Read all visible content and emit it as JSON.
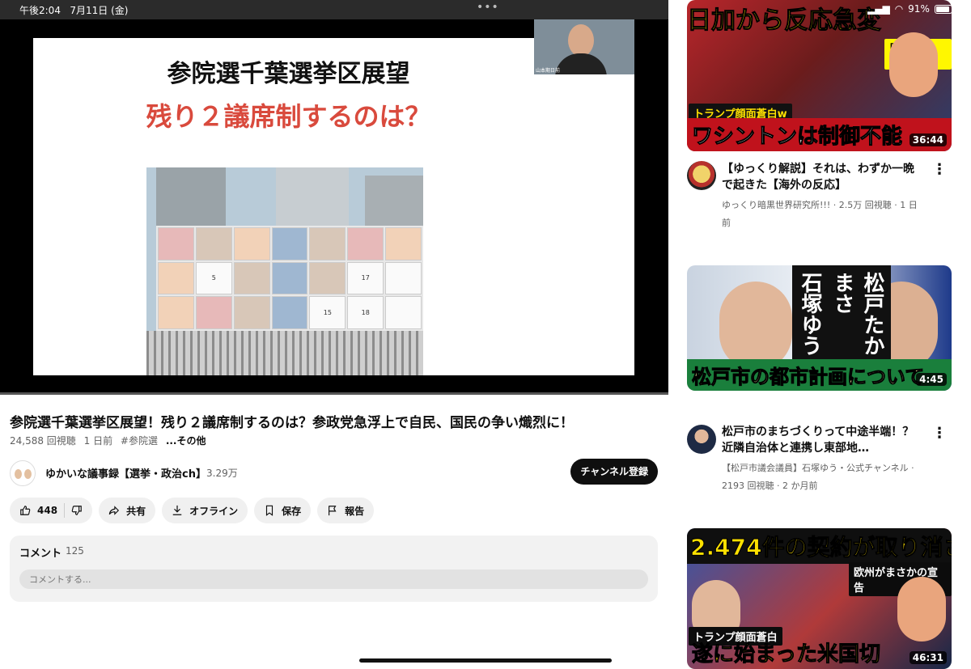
{
  "status_bar": {
    "time": "午後2:04",
    "date": "7月11日 (金)",
    "battery": "91%"
  },
  "slide": {
    "title": "参院選千葉選挙区展望",
    "subtitle": "残り２議席制するのは？",
    "board_numbers": [
      "5",
      "17",
      "15",
      "18"
    ],
    "webcam_tag": "山本期日前"
  },
  "video": {
    "title": "参院選千葉選挙区展望！残り２議席制するのは？参政党急浮上で自民、国民の争い熾烈に！",
    "views": "24,588 回視聴",
    "age": "1 日前",
    "hashtag": "#参院選",
    "more": "...その他"
  },
  "channel": {
    "name": "ゆかいな議事録【選挙・政治ch】",
    "subs": "3.29万",
    "subscribe_label": "チャンネル登録"
  },
  "actions": {
    "like_count": "448",
    "share": "共有",
    "offline": "オフライン",
    "save": "保存",
    "report": "報告"
  },
  "comments": {
    "header": "コメント",
    "count": "125",
    "placeholder": "コメントする..."
  },
  "recommended": [
    {
      "thumb_top": "日加から反応急変",
      "thumb_tag": "目を疑った…",
      "thumb_mid": "トランプ顔面蒼白w",
      "thumb_bottom": "ワシントンは制御不能",
      "duration": "36:44",
      "title": "【ゆっくり解説】それは、わずか一晩で起きた【海外の反応】",
      "meta": "ゆっくり暗黒世界研究所!!! · 2.5万 回視聴 · 1 日前"
    },
    {
      "thumb_names_1": "石塚ゆう",
      "thumb_names_2": "松戸たかまさ",
      "thumb_bottom": "松戸市の都市計画について",
      "duration": "4:45",
      "title": "松戸市のまちづくりって中途半端！？近隣自治体と連携し東部地…",
      "meta": "【松戸市議会議員】石塚ゆう・公式チャンネル · 2193 回視聴 · 2 か月前"
    },
    {
      "thumb_top": "2.474件の契約が取り消され",
      "thumb_tag": "欧州がまさかの宣告",
      "thumb_mid": "トランプ顔面蒼白",
      "thumb_bottom": "遂に始まった米国切",
      "duration": "46:31"
    }
  ]
}
